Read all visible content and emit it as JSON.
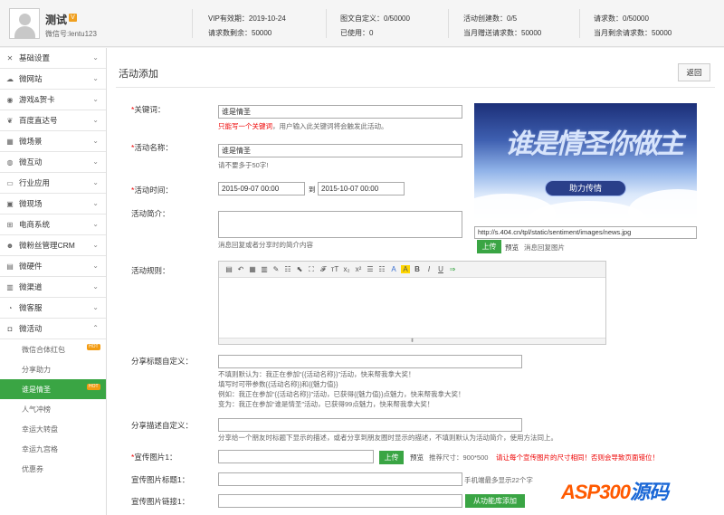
{
  "user": {
    "name": "测试",
    "badge": "V",
    "wechat": "微信号:lentu123"
  },
  "stats": {
    "vip": "VIP有效期：2019-10-24",
    "req_left": "请求数剩余：50000",
    "graphic": "图文自定义：0/50000",
    "used": "已使用：0",
    "activities": "活动创建数：0/5",
    "month_gift": "当月赠送请求数：50000",
    "requests": "请求数：0/50000",
    "month_left": "当月剩余请求数：50000"
  },
  "sidebar": {
    "items": [
      {
        "label": "基础设置",
        "icon": "wrench-icon"
      },
      {
        "label": "微网站",
        "icon": "cloud-icon"
      },
      {
        "label": "游戏&贺卡",
        "icon": "gamepad-icon"
      },
      {
        "label": "百度直达号",
        "icon": "paw-icon"
      },
      {
        "label": "微场景",
        "icon": "film-icon"
      },
      {
        "label": "微互动",
        "icon": "chat-icon"
      },
      {
        "label": "行业应用",
        "icon": "folder-icon"
      },
      {
        "label": "微现场",
        "icon": "video-icon"
      },
      {
        "label": "电商系统",
        "icon": "cart-icon"
      },
      {
        "label": "微粉丝管理CRM",
        "icon": "users-icon"
      },
      {
        "label": "微硬件",
        "icon": "hardware-icon"
      },
      {
        "label": "微渠道",
        "icon": "channel-icon"
      },
      {
        "label": "微客服",
        "icon": "headset-icon"
      },
      {
        "label": "微活动",
        "icon": "gift-icon"
      }
    ],
    "sub": [
      {
        "label": "微信合体红包",
        "badge": "HOT"
      },
      {
        "label": "分享助力",
        "badge": ""
      },
      {
        "label": "谁是情圣",
        "badge": "HOT"
      },
      {
        "label": "人气冲榜",
        "badge": ""
      },
      {
        "label": "幸运大转盘",
        "badge": ""
      },
      {
        "label": "幸运九宫格",
        "badge": ""
      },
      {
        "label": "优惠券",
        "badge": ""
      }
    ]
  },
  "page": {
    "title": "活动添加",
    "back": "返回"
  },
  "form": {
    "keyword": {
      "label": "关键词：",
      "value": "谁是情圣",
      "hint_red": "只能写一个关键词",
      "hint": "，用户输入此关键词将会触发此活动。"
    },
    "name": {
      "label": "活动名称：",
      "value": "谁是情圣",
      "hint": "请不要多于50字!"
    },
    "time": {
      "label": "活动时间：",
      "start": "2015-09-07 00:00",
      "to": "到",
      "end": "2015-10-07 00:00"
    },
    "intro": {
      "label": "活动简介：",
      "hint": "消息回复或者分享时的简介内容"
    },
    "banner": {
      "url": "http://s.404.cn/tpl/static/sentiment/images/news.jpg",
      "upload": "上传",
      "preview": "预览",
      "caption": "消息回复图片",
      "text1": "谁是情圣你做主",
      "text2": "助力传情"
    },
    "rules": {
      "label": "活动规则："
    },
    "share_title": {
      "label": "分享标题自定义：",
      "lines": [
        "不填则默认为：我正在参加“{{活动名称}}”活动，快来帮我拿大奖！",
        "填写时可带参数{{活动名称}}和{{魅力值}}",
        "例如：我正在参加“{{活动名称}}”活动，已获得{{魅力值}}点魅力，快来帮我拿大奖！",
        "变为：我正在参加“谁是情圣”活动，已获得99点魅力，快来帮我拿大奖！"
      ]
    },
    "share_desc": {
      "label": "分享描述自定义：",
      "hint": "分享给一个朋友时标题下显示的描述，或者分享到朋友圈时显示的描述，不填则默认为活动简介，使用方法同上。"
    },
    "promo_img": {
      "label": "宣传图片1：",
      "upload": "上传",
      "preview": "预览",
      "size": "推荐尺寸：900*500",
      "warn": "请让每个宣传图片的尺寸相同！否则会导致页面错位！"
    },
    "promo_title": {
      "label": "宣传图片标题1：",
      "hint": "手机端最多显示22个字"
    },
    "promo_link": {
      "label": "宣传图片链接1：",
      "button": "从功能库添加"
    }
  },
  "toolbar": [
    "▤",
    "↶",
    "▦",
    "▥",
    "✎",
    "☷",
    "⬉",
    "⛶",
    "𝓕",
    "ᴛT",
    "x₂",
    "x²",
    "☰",
    "☷",
    "A",
    "A",
    "B",
    "I",
    "U",
    "⇒"
  ],
  "watermark": {
    "a": "ASP300",
    "b": "源码"
  }
}
